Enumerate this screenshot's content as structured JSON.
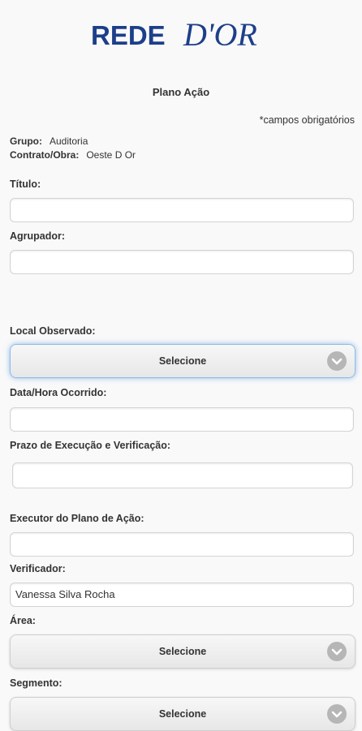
{
  "brand": {
    "rede": "REDE",
    "dor": "D'OR"
  },
  "page_title": "Plano Ação",
  "required_note": "*campos obrigatórios",
  "grupo": {
    "label": "Grupo:",
    "value": "Auditoria"
  },
  "contrato": {
    "label": "Contrato/Obra:",
    "value": "Oeste D Or"
  },
  "fields": {
    "titulo": {
      "label": "Título:",
      "value": ""
    },
    "agrupador": {
      "label": "Agrupador:",
      "value": ""
    },
    "local": {
      "label": "Local Observado:",
      "value": "Selecione"
    },
    "data_hora": {
      "label": "Data/Hora Ocorrido:",
      "value": ""
    },
    "prazo": {
      "label": "Prazo de Execução e Verificação:",
      "value": ""
    },
    "executor": {
      "label": "Executor do Plano de Ação:",
      "value": ""
    },
    "verificador": {
      "label": "Verificador:",
      "value": "Vanessa Silva Rocha"
    },
    "area": {
      "label": "Área:",
      "value": "Selecione"
    },
    "segmento": {
      "label": "Segmento:",
      "value": "Selecione"
    }
  },
  "colors": {
    "brand_blue": "#1d3f8a",
    "focus_glow": "#8ebbe5"
  },
  "icons": {
    "select_chevron": "chevron-down-circle-icon"
  }
}
